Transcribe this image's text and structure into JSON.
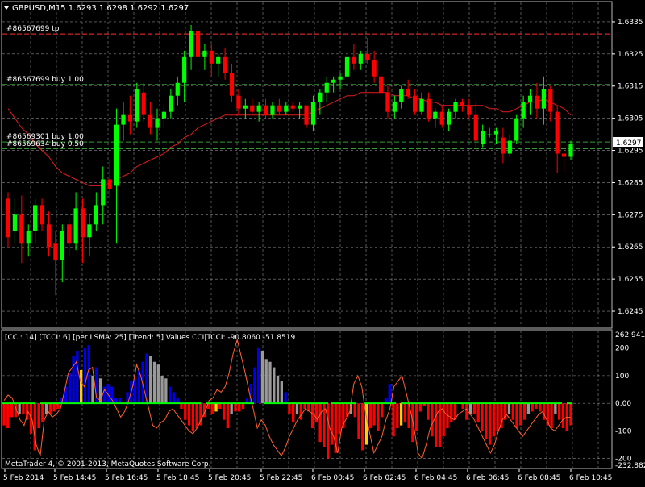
{
  "window": {
    "symbol_header": "GBPUSD,M15  1.6293 1.6298 1.6292 1.6297",
    "copyright": "MetaTrader 4, © 2001-2013, MetaQuotes Software Corp."
  },
  "colors": {
    "background": "#000000",
    "grid": "#8a8a8a",
    "bull_candle": "#00ff00",
    "bear_candle": "#ff0000",
    "moving_average": "#e21b1b",
    "tp_line": "#ff3030",
    "order_line": "#2f9e2f",
    "axis_text": "#ffffff",
    "cci_up": "#0000ee",
    "cci_down": "#ff0000",
    "cci_neutral": "#9a9a9a",
    "cci_signal": "#ffd000",
    "cci_trend": "#00ff00",
    "cci_line": "#ff6030"
  },
  "orders": [
    {
      "label": "#86567699 tp",
      "price": 1.63312,
      "kind": "tp"
    },
    {
      "label": "#86567699 buy 1.00",
      "price": 1.63155,
      "kind": "order"
    },
    {
      "label": "#86569301 buy 1.00",
      "price": 1.62976,
      "kind": "order"
    },
    {
      "label": "#86569634 buy 0.50",
      "price": 1.62955,
      "kind": "order"
    }
  ],
  "price_axis": {
    "ticks": [
      "1.6335",
      "1.6325",
      "1.6315",
      "1.6305",
      "1.6295",
      "1.6285",
      "1.6275",
      "1.6265",
      "1.6255",
      "1.6245"
    ],
    "current_price": "1.6297"
  },
  "time_axis": {
    "labels": [
      "5 Feb 2014",
      "5 Feb 14:45",
      "5 Feb 16:45",
      "5 Feb 18:45",
      "5 Feb 20:45",
      "5 Feb 22:45",
      "6 Feb 00:45",
      "6 Feb 02:45",
      "6 Feb 04:45",
      "6 Feb 06:45",
      "6 Feb 08:45",
      "6 Feb 10:45"
    ]
  },
  "indicator": {
    "header": "[CCI: 14] [TCCI: 6] [per LSMA: 25] [Trend: 5] Values CCI|TCCI: -90.8060 -51.8519",
    "axis_labels": [
      "262.9415",
      "200",
      "100",
      "0.00",
      "-100",
      "-200",
      "-232.8824"
    ]
  },
  "chart_data": [
    {
      "type": "candlestick",
      "title": "GBPUSD,M15  1.6293 1.6298 1.6292 1.6297",
      "ylim": [
        1.624,
        1.6341
      ],
      "x_labels": [
        "5 Feb 2014",
        "5 Feb 14:45",
        "5 Feb 16:45",
        "5 Feb 18:45",
        "5 Feb 20:45",
        "5 Feb 22:45",
        "6 Feb 00:45",
        "6 Feb 02:45",
        "6 Feb 04:45",
        "6 Feb 06:45",
        "6 Feb 08:45",
        "6 Feb 10:45"
      ],
      "ohlc": [
        [
          1.628,
          1.6282,
          1.6265,
          1.6268
        ],
        [
          1.627,
          1.628,
          1.6266,
          1.6275
        ],
        [
          1.6275,
          1.6281,
          1.626,
          1.6266
        ],
        [
          1.6266,
          1.6272,
          1.6262,
          1.627
        ],
        [
          1.627,
          1.628,
          1.6266,
          1.6278
        ],
        [
          1.6278,
          1.628,
          1.627,
          1.6272
        ],
        [
          1.6272,
          1.6276,
          1.6262,
          1.6265
        ],
        [
          1.6266,
          1.627,
          1.625,
          1.6261
        ],
        [
          1.6261,
          1.6272,
          1.6254,
          1.627
        ],
        [
          1.6272,
          1.6274,
          1.6262,
          1.6266
        ],
        [
          1.6266,
          1.6282,
          1.6264,
          1.6277
        ],
        [
          1.6277,
          1.628,
          1.626,
          1.6268
        ],
        [
          1.6268,
          1.6275,
          1.6262,
          1.6272
        ],
        [
          1.6272,
          1.6282,
          1.627,
          1.6278
        ],
        [
          1.6278,
          1.629,
          1.6272,
          1.6286
        ],
        [
          1.6286,
          1.6292,
          1.628,
          1.6283
        ],
        [
          1.6284,
          1.6308,
          1.6266,
          1.6303
        ],
        [
          1.6303,
          1.631,
          1.6298,
          1.6306
        ],
        [
          1.6306,
          1.6312,
          1.63,
          1.6304
        ],
        [
          1.6304,
          1.6316,
          1.6302,
          1.6314
        ],
        [
          1.6313,
          1.6316,
          1.6304,
          1.6306
        ],
        [
          1.6306,
          1.631,
          1.63,
          1.6302
        ],
        [
          1.6302,
          1.6308,
          1.6298,
          1.6305
        ],
        [
          1.6305,
          1.6309,
          1.6302,
          1.6307
        ],
        [
          1.6307,
          1.6314,
          1.6305,
          1.6312
        ],
        [
          1.6312,
          1.6318,
          1.6309,
          1.6316
        ],
        [
          1.6316,
          1.6326,
          1.631,
          1.6324
        ],
        [
          1.6324,
          1.6334,
          1.632,
          1.6332
        ],
        [
          1.6332,
          1.6334,
          1.6322,
          1.6324
        ],
        [
          1.6324,
          1.6328,
          1.632,
          1.6326
        ],
        [
          1.6326,
          1.6328,
          1.6318,
          1.6322
        ],
        [
          1.6322,
          1.6325,
          1.6318,
          1.6324
        ],
        [
          1.6324,
          1.6327,
          1.6317,
          1.6319
        ],
        [
          1.6319,
          1.6322,
          1.631,
          1.6312
        ],
        [
          1.6312,
          1.6314,
          1.6306,
          1.6308
        ],
        [
          1.6308,
          1.6311,
          1.6305,
          1.6309
        ],
        [
          1.6309,
          1.6311,
          1.6306,
          1.6307
        ],
        [
          1.6307,
          1.631,
          1.6304,
          1.6309
        ],
        [
          1.6309,
          1.6311,
          1.6305,
          1.6306
        ],
        [
          1.6306,
          1.631,
          1.6305,
          1.6309
        ],
        [
          1.6309,
          1.6311,
          1.6306,
          1.6307
        ],
        [
          1.6307,
          1.631,
          1.6306,
          1.6309
        ],
        [
          1.6309,
          1.631,
          1.6307,
          1.6308
        ],
        [
          1.6308,
          1.631,
          1.6305,
          1.6309
        ],
        [
          1.6309,
          1.6309,
          1.6302,
          1.6303
        ],
        [
          1.6303,
          1.6312,
          1.6301,
          1.631
        ],
        [
          1.631,
          1.6314,
          1.6306,
          1.6313
        ],
        [
          1.6313,
          1.6318,
          1.631,
          1.6316
        ],
        [
          1.6316,
          1.6318,
          1.6313,
          1.6317
        ],
        [
          1.6317,
          1.6319,
          1.6314,
          1.6318
        ],
        [
          1.6318,
          1.6326,
          1.6316,
          1.6324
        ],
        [
          1.6324,
          1.6328,
          1.632,
          1.6322
        ],
        [
          1.6322,
          1.6326,
          1.632,
          1.6325
        ],
        [
          1.6325,
          1.633,
          1.6322,
          1.6323
        ],
        [
          1.6323,
          1.6326,
          1.6316,
          1.6318
        ],
        [
          1.6318,
          1.632,
          1.631,
          1.6313
        ],
        [
          1.6313,
          1.6315,
          1.6305,
          1.6307
        ],
        [
          1.6307,
          1.6312,
          1.6305,
          1.631
        ],
        [
          1.631,
          1.6315,
          1.6308,
          1.6314
        ],
        [
          1.6314,
          1.6317,
          1.6311,
          1.6312
        ],
        [
          1.6312,
          1.6314,
          1.6306,
          1.6307
        ],
        [
          1.6307,
          1.6313,
          1.6306,
          1.6311
        ],
        [
          1.6311,
          1.6313,
          1.6304,
          1.6305
        ],
        [
          1.6305,
          1.6308,
          1.6302,
          1.6307
        ],
        [
          1.6307,
          1.6309,
          1.6302,
          1.6303
        ],
        [
          1.6303,
          1.6308,
          1.6301,
          1.6307
        ],
        [
          1.6307,
          1.6311,
          1.6305,
          1.631
        ],
        [
          1.631,
          1.6311,
          1.6307,
          1.6309
        ],
        [
          1.6309,
          1.6311,
          1.6305,
          1.6306
        ],
        [
          1.6306,
          1.631,
          1.6296,
          1.6298
        ],
        [
          1.6297,
          1.6303,
          1.6296,
          1.6301
        ],
        [
          1.63,
          1.6302,
          1.6299,
          1.63
        ],
        [
          1.63,
          1.6302,
          1.6297,
          1.6301
        ],
        [
          1.6299,
          1.6302,
          1.6291,
          1.6294
        ],
        [
          1.6294,
          1.63,
          1.6293,
          1.6298
        ],
        [
          1.6298,
          1.6306,
          1.6297,
          1.6305
        ],
        [
          1.6305,
          1.6312,
          1.6302,
          1.631
        ],
        [
          1.631,
          1.6314,
          1.6306,
          1.6312
        ],
        [
          1.6312,
          1.6316,
          1.6305,
          1.6308
        ],
        [
          1.6308,
          1.6318,
          1.6303,
          1.6314
        ],
        [
          1.6314,
          1.6315,
          1.6304,
          1.6307
        ],
        [
          1.6307,
          1.6309,
          1.6288,
          1.6294
        ],
        [
          1.6294,
          1.6297,
          1.6288,
          1.6293
        ],
        [
          1.6293,
          1.6298,
          1.6292,
          1.6297
        ]
      ],
      "moving_average": [
        1.6308,
        1.6305,
        1.6302,
        1.63,
        1.6297,
        1.6295,
        1.6293,
        1.629,
        1.6288,
        1.6287,
        1.6286,
        1.6285,
        1.6284,
        1.6284,
        1.6284,
        1.6285,
        1.6286,
        1.6287,
        1.6288,
        1.629,
        1.6291,
        1.6292,
        1.6293,
        1.6294,
        1.6296,
        1.6297,
        1.6299,
        1.63,
        1.6302,
        1.6303,
        1.6304,
        1.6305,
        1.6306,
        1.6306,
        1.6306,
        1.6306,
        1.6306,
        1.6306,
        1.6306,
        1.6306,
        1.6306,
        1.6306,
        1.6306,
        1.6306,
        1.6306,
        1.6307,
        1.6308,
        1.6309,
        1.631,
        1.6311,
        1.6312,
        1.6312,
        1.6313,
        1.6313,
        1.6313,
        1.6313,
        1.6313,
        1.6312,
        1.6312,
        1.6312,
        1.6311,
        1.6311,
        1.631,
        1.631,
        1.6309,
        1.6309,
        1.6309,
        1.6309,
        1.6309,
        1.6309,
        1.6309,
        1.6308,
        1.6308,
        1.6307,
        1.6307,
        1.6308,
        1.6309,
        1.631,
        1.631,
        1.6311,
        1.631,
        1.6309,
        1.6308,
        1.6306
      ]
    },
    {
      "type": "bar",
      "title": "[CCI: 14] [TCCI: 6] [per LSMA: 25] [Trend: 5] Values CCI|TCCI: -90.8060 -51.8519",
      "ylim": [
        -232.8824,
        262.9415
      ],
      "cci": [
        -80,
        -90,
        -50,
        -50,
        -40,
        -40,
        -60,
        -110,
        -170,
        -90,
        -70,
        -40,
        -40,
        -30,
        -20,
        20,
        60,
        110,
        170,
        190,
        120,
        200,
        210,
        100,
        130,
        90,
        60,
        70,
        60,
        20,
        20,
        0,
        40,
        80,
        90,
        120,
        150,
        180,
        170,
        150,
        140,
        100,
        90,
        60,
        40,
        20,
        -20,
        -60,
        -80,
        -100,
        -90,
        -80,
        -50,
        -20,
        -40,
        -30,
        -20,
        -60,
        -90,
        -40,
        -30,
        -30,
        -20,
        20,
        70,
        130,
        200,
        190,
        160,
        150,
        130,
        100,
        80,
        40,
        -40,
        -70,
        -40,
        -60,
        -20,
        -30,
        -90,
        -70,
        -140,
        -160,
        -200,
        -150,
        -180,
        -110,
        -90,
        -50,
        -40,
        -50,
        -130,
        -170,
        -150,
        -90,
        -80,
        -100,
        -50,
        20,
        70,
        -120,
        -90,
        -80,
        -70,
        -90,
        -140,
        -100,
        -30,
        -10,
        -60,
        -120,
        -160,
        -160,
        -120,
        -90,
        -70,
        -60,
        0,
        -20,
        -60,
        -40,
        -40,
        -70,
        -100,
        -130,
        -150,
        -120,
        -100,
        -90,
        -60,
        -40,
        -60,
        -90,
        -80,
        -60,
        -40,
        -30,
        -20,
        -30,
        -60,
        -80,
        -90,
        -40,
        -60,
        -90,
        -100,
        -80
      ],
      "tcci": [
        10,
        30,
        20,
        -20,
        -60,
        -80,
        -30,
        -60,
        -150,
        -190,
        -60,
        -30,
        -50,
        -40,
        -20,
        40,
        110,
        130,
        150,
        80,
        60,
        120,
        130,
        20,
        10,
        50,
        30,
        10,
        -20,
        -50,
        -30,
        10,
        60,
        140,
        100,
        40,
        -20,
        -80,
        -90,
        -70,
        -60,
        -30,
        -20,
        -40,
        -60,
        -80,
        -100,
        -110,
        -90,
        -60,
        -30,
        10,
        20,
        50,
        40,
        60,
        110,
        180,
        230,
        170,
        110,
        40,
        -20,
        -90,
        -60,
        -80,
        -120,
        -150,
        -170,
        -190,
        -160,
        -120,
        -90,
        -60,
        -40,
        -20,
        -30,
        -40,
        -60,
        -30,
        -20,
        -90,
        -120,
        -180,
        -90,
        -60,
        -30,
        70,
        100,
        60,
        -40,
        -110,
        -180,
        -150,
        -120,
        -60,
        -20,
        60,
        80,
        100,
        40,
        -20,
        -90,
        -180,
        -200,
        -150,
        -90,
        -60,
        -30,
        -20,
        -40,
        -50,
        -60,
        -40,
        -30,
        -20,
        -40,
        -60,
        -90,
        -120,
        -150,
        -180,
        -150,
        -100,
        -60,
        -40,
        -60,
        -80,
        -100,
        -120,
        -100,
        -80,
        -60,
        -40,
        -30,
        -60,
        -90,
        -100,
        -80,
        -60,
        -50,
        -52
      ]
    }
  ]
}
